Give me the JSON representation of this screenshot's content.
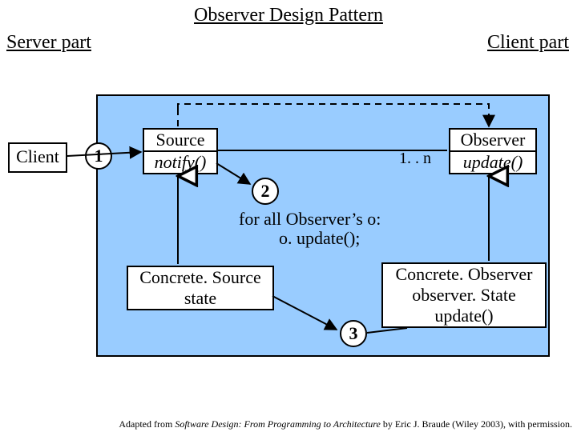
{
  "title": "Observer Design Pattern",
  "headers": {
    "server": "Server part",
    "client": "Client part"
  },
  "clientBox": "Client",
  "source": {
    "name": "Source",
    "method": "notify()"
  },
  "observer": {
    "name": "Observer",
    "method": "update()"
  },
  "concreteSource": {
    "name": "Concrete. Source",
    "attr": "state"
  },
  "concreteObserver": {
    "name": "Concrete. Observer",
    "attr": "observer. State",
    "method": "update()"
  },
  "multiplicity": "1. . n",
  "loopText1": "for all Observer’s o:",
  "loopText2": "o. update();",
  "steps": {
    "s1": "1",
    "s2": "2",
    "s3": "3"
  },
  "credit_prefix": "Adapted from ",
  "credit_title": "Software Design: From Programming to Architecture",
  "credit_suffix": " by Eric J. Braude (Wiley 2003), with permission."
}
